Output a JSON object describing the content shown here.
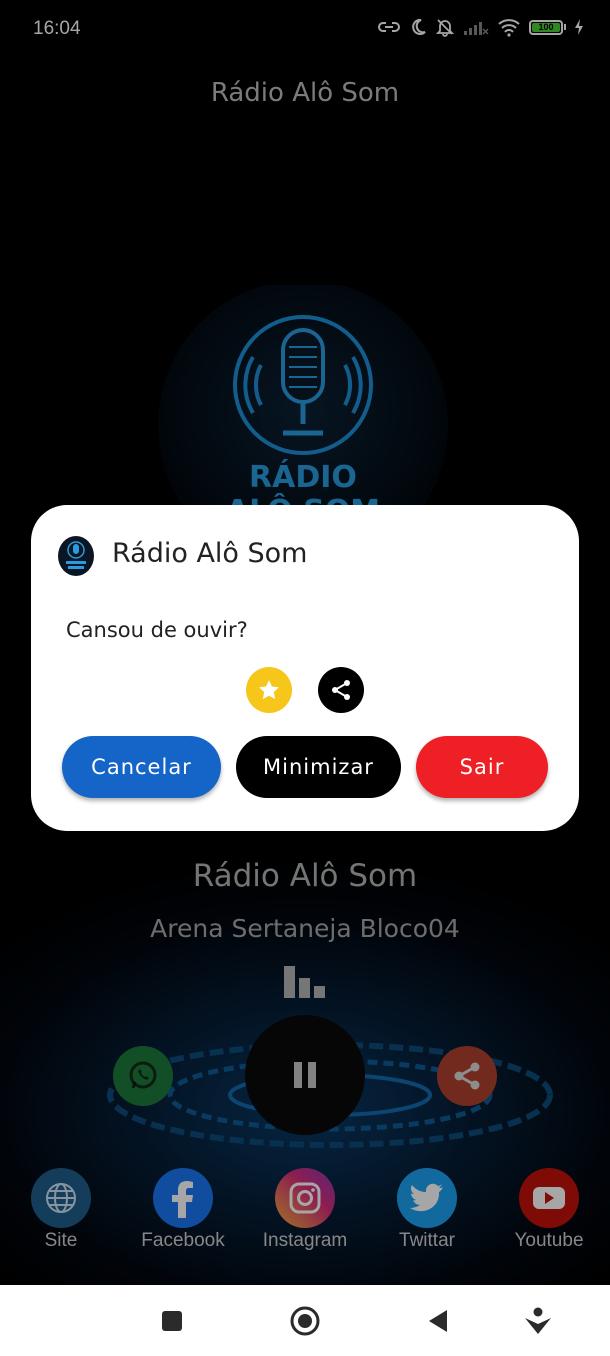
{
  "status_bar": {
    "time": "16:04",
    "battery_label": "100",
    "icons": [
      "link-icon",
      "moon-icon",
      "bell-off-icon",
      "signal-icon",
      "wifi-icon",
      "battery-icon",
      "charging-icon"
    ]
  },
  "app": {
    "title": "Rádio Alô Som",
    "logo_text": [
      "RÁDIO",
      "ALÔ SOM"
    ]
  },
  "player": {
    "station_name": "Rádio Alô Som",
    "now_playing": "Arena Sertaneja Bloco04",
    "state": "playing"
  },
  "dialog": {
    "title": "Rádio Alô Som",
    "message": "Cansou de ouvir?",
    "buttons": {
      "cancel": "Cancelar",
      "minimize": "Minimizar",
      "exit": "Sair"
    }
  },
  "social": [
    {
      "label": "Site",
      "icon": "globe-icon",
      "color": "#1e5f8a"
    },
    {
      "label": "Facebook",
      "icon": "facebook-icon",
      "color": "#1977f3"
    },
    {
      "label": "Instagram",
      "icon": "instagram-icon",
      "color": "#c13584"
    },
    {
      "label": "Twittar",
      "icon": "twitter-icon",
      "color": "#1da1f2"
    },
    {
      "label": "Youtube",
      "icon": "youtube-icon",
      "color": "#c4120b"
    }
  ],
  "colors": {
    "cancel": "#1565c8",
    "minimize": "#000000",
    "exit": "#ee2026",
    "star": "#f6c61a",
    "accent_glow": "#1e9bf0"
  },
  "nav_bar": [
    "square-icon",
    "home-circle-icon",
    "back-triangle-icon",
    "assistant-icon"
  ]
}
